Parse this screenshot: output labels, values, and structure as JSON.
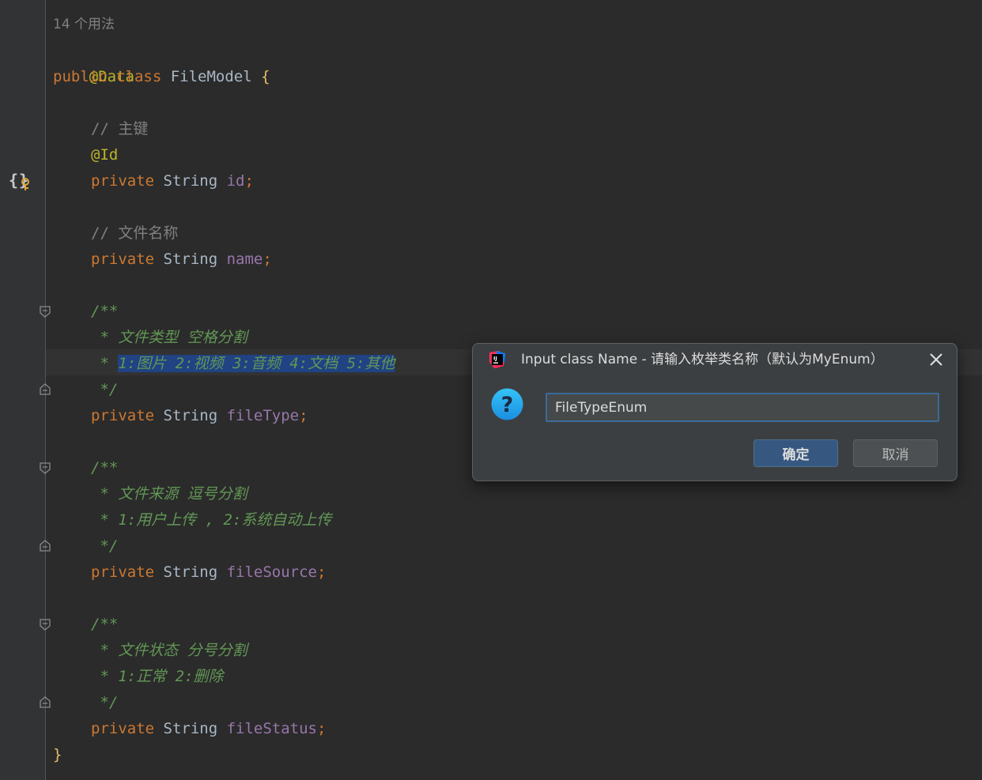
{
  "editor": {
    "usages": "14 个用法",
    "lines": {
      "l2_ann": "@Data",
      "l3_kw": "public class ",
      "l3_name": "FileModel ",
      "l3_brace": "{",
      "c_id": "// 主键",
      "ann_id": "@Id",
      "kw_private": "private ",
      "type_string": "String ",
      "f_id": "id",
      "semi": ";",
      "c_name": "// 文件名称",
      "f_name": "name",
      "doc_open": "/**",
      "doc_close": " */",
      "doc_type_1": " * 文件类型 空格分割",
      "doc_type_2_prefix": " * ",
      "doc_type_2_sel": "1:图片 2:视频 3:音频 4:文档 5:其他",
      "f_fileType": "fileType",
      "doc_source_1": " * 文件来源 逗号分割",
      "doc_source_2": " * 1:用户上传 , 2:系统自动上传",
      "f_fileSource": "fileSource",
      "doc_status_1": " * 文件状态 分号分割",
      "doc_status_2": " * 1:正常 2:删除",
      "f_fileStatus": "fileStatus",
      "close_brace": "}"
    }
  },
  "dialog": {
    "title": "Input class Name - 请输入枚举类名称（默认为MyEnum）",
    "input_value": "FileTypeEnum",
    "ok_label": "确定",
    "cancel_label": "取消",
    "logo_icon": "intellij-idea-icon",
    "question_icon": "question-icon",
    "close_icon": "close-icon"
  },
  "colors": {
    "background": "#2b2b2b",
    "keyword": "#cc7832",
    "annotation": "#bbb529",
    "field": "#9876aa",
    "doc_comment": "#629755",
    "line_comment": "#808080",
    "selection": "#214283",
    "dialog_bg": "#3c3f41",
    "primary_button": "#365880"
  }
}
